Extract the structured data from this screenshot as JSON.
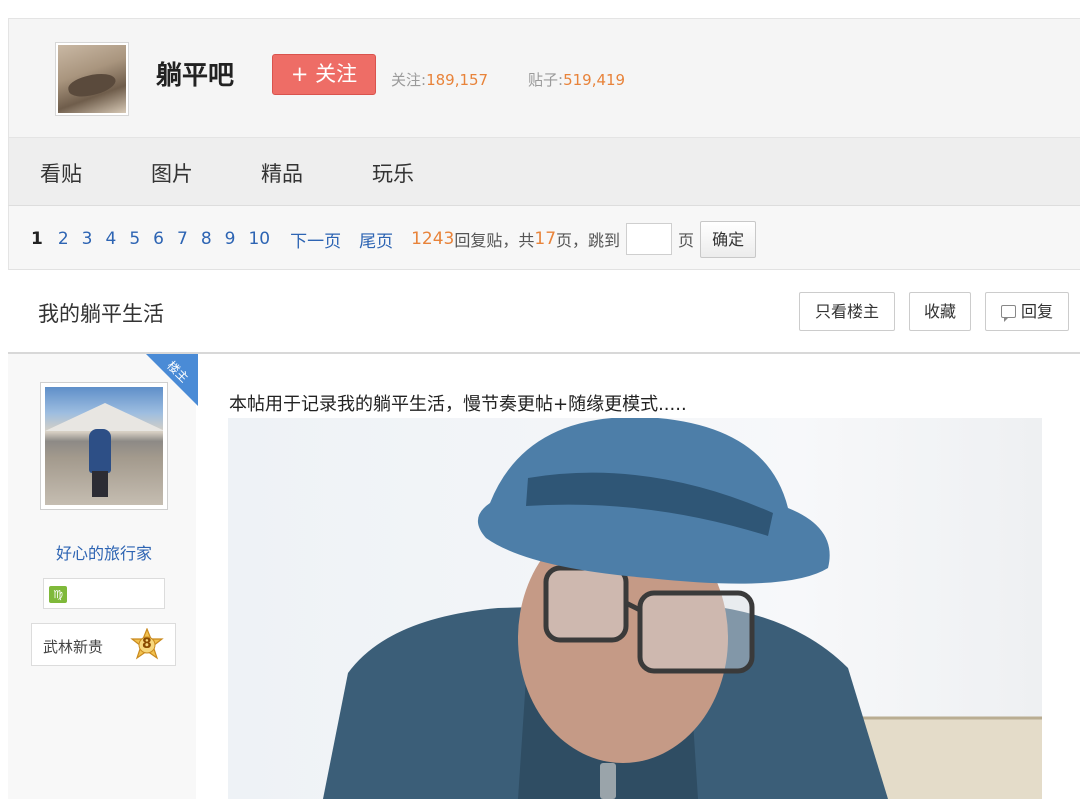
{
  "forum": {
    "name": "躺平吧",
    "follow_label": "+ 关注",
    "follow_stat_label": "关注:",
    "follow_stat_value": "189,157",
    "posts_stat_label": "贴子:",
    "posts_stat_value": "519,419"
  },
  "nav": {
    "items": [
      {
        "label": "看贴"
      },
      {
        "label": "图片"
      },
      {
        "label": "精品"
      },
      {
        "label": "玩乐"
      }
    ]
  },
  "pager": {
    "current": "1",
    "pages": [
      "2",
      "3",
      "4",
      "5",
      "6",
      "7",
      "8",
      "9",
      "10"
    ],
    "next_label": "下一页",
    "last_label": "尾页",
    "reply_count": "1243",
    "reply_suffix": "回复贴，共",
    "page_count": "17",
    "page_suffix": "页，跳到",
    "jump_unit": "页",
    "confirm_label": "确定"
  },
  "thread": {
    "title": "我的躺平生活",
    "only_author_label": "只看楼主",
    "favorite_label": "收藏",
    "reply_label": "回复"
  },
  "post": {
    "author_tag": "楼主",
    "author_name": "好心的旅行家",
    "level_icon": "♍",
    "badge_label": "武林新贵",
    "badge_level": "8",
    "text": "本帖用于记录我的躺平生活，慢节奏更帖+随缘更模式....."
  },
  "colors": {
    "follow_button": "#ee6d66",
    "link_blue": "#2d64b3",
    "number_orange": "#e8833a",
    "author_tag_blue": "#4a8bd6"
  }
}
